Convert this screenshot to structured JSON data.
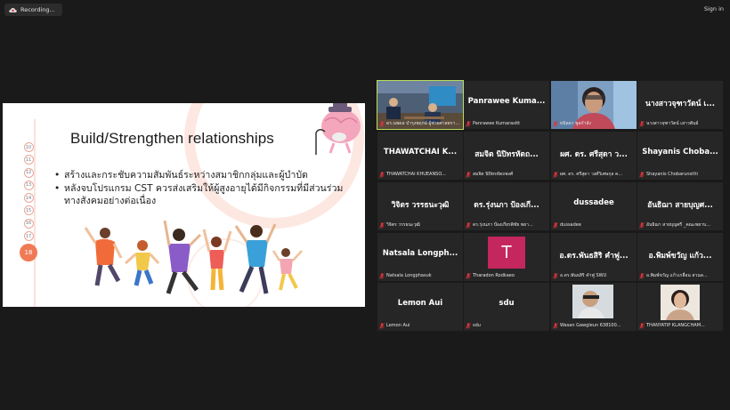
{
  "topbar": {
    "recording_label": "Recording...",
    "signin_label": "Sign in"
  },
  "slide": {
    "title": "Build/Strengthen relationships",
    "bullets": [
      "สร้างและกระชับความสัมพันธ์ระหว่างสมาชิกกลุ่มและผู้บำบัด",
      "หลังจบโปรแกรม CST  ควรส่งเสริมให้ผู้สูงอายุได้มีกิจกรรมที่มีส่วนร่วมทางสังคมอย่างต่อเนื่อง"
    ],
    "page_numbers": [
      "10",
      "11",
      "12",
      "13",
      "14",
      "15",
      "16",
      "17"
    ],
    "current_page": "18"
  },
  "participants": [
    {
      "label": "ดร.นพดล บำรุงพฤกษ์ ผู้ช่วยศาสตราจารย์ ม.ควินส์...",
      "display": "",
      "type": "video-room"
    },
    {
      "label": "Panrawee Kumarasitt",
      "display": "Panrawee Kuma...",
      "type": "name"
    },
    {
      "label": "ธนิลดา พูลกำลัง",
      "display": "",
      "type": "video-woman"
    },
    {
      "label": "นางสาวจุฑาวัตน์ เสาวพันธ์",
      "display": "นางสาวจุฑาวัตน์ เ...",
      "type": "name"
    },
    {
      "label": "THAWATCHAI KHUEANSO...",
      "display": "THAWATCHAI  K...",
      "type": "name"
    },
    {
      "label": "สมจิต นิปิทรหัตถพงศ์",
      "display": "สมจิต นิปิทรหัตถ...",
      "type": "name"
    },
    {
      "label": "ผศ. ดร. ศรีสุดา วงศ์วิเศษกุล ค...",
      "display": "ผศ. ดร. ศรีสุดา ว...",
      "type": "name"
    },
    {
      "label": "Shayanis Chobarunsitti",
      "display": "Shayanis Choba...",
      "type": "name"
    },
    {
      "label": "วิจิตร วรรธนะวุฒิ",
      "display": "วิจิตร วรรธนะวุฒิ",
      "type": "name"
    },
    {
      "label": "ดร.รุ่งนภา ป้องเกียรติชัย พยา...",
      "display": "ดร.รุ่งนภา ป้องเกี...",
      "type": "name"
    },
    {
      "label": "dussadee",
      "display": "dussadee",
      "type": "name"
    },
    {
      "label": "อันธิฌา สายบุญศรี _คณะพยาบ...",
      "display": "อันธิฌา สายบุญศ...",
      "type": "name"
    },
    {
      "label": "Natsala Longphasuk",
      "display": "Natsala  Longph...",
      "type": "name"
    },
    {
      "label": "Tharadon Rodkaeo",
      "display": "",
      "type": "avatar",
      "avatar_letter": "T"
    },
    {
      "label": "อ.ดร.พันธสิริ คำฟู SWU",
      "display": "อ.ดร.พันธสิริ คำฟู...",
      "type": "name"
    },
    {
      "label": "อ.พิมพ์ขวัญ แก้วเกลื่อน สวนด...",
      "display": "อ.พิมพ์ขวัญ แก้ว...",
      "type": "name"
    },
    {
      "label": "Lemon Aui",
      "display": "Lemon Aui",
      "type": "name"
    },
    {
      "label": "sdu",
      "display": "sdu",
      "type": "name"
    },
    {
      "label": "Wasan Gawgleun 638100...",
      "display": "",
      "type": "video-man"
    },
    {
      "label": "THANYATIP KLANGCHAM...",
      "display": "",
      "type": "video-woman2"
    }
  ],
  "colors": {
    "background": "#1a1a1a",
    "tile": "#262626",
    "active_speaker_border": "#b6df5a",
    "muted_mic": "#e0343c",
    "avatar_bg": "#c4265e",
    "slide_accent": "#f07a55"
  }
}
